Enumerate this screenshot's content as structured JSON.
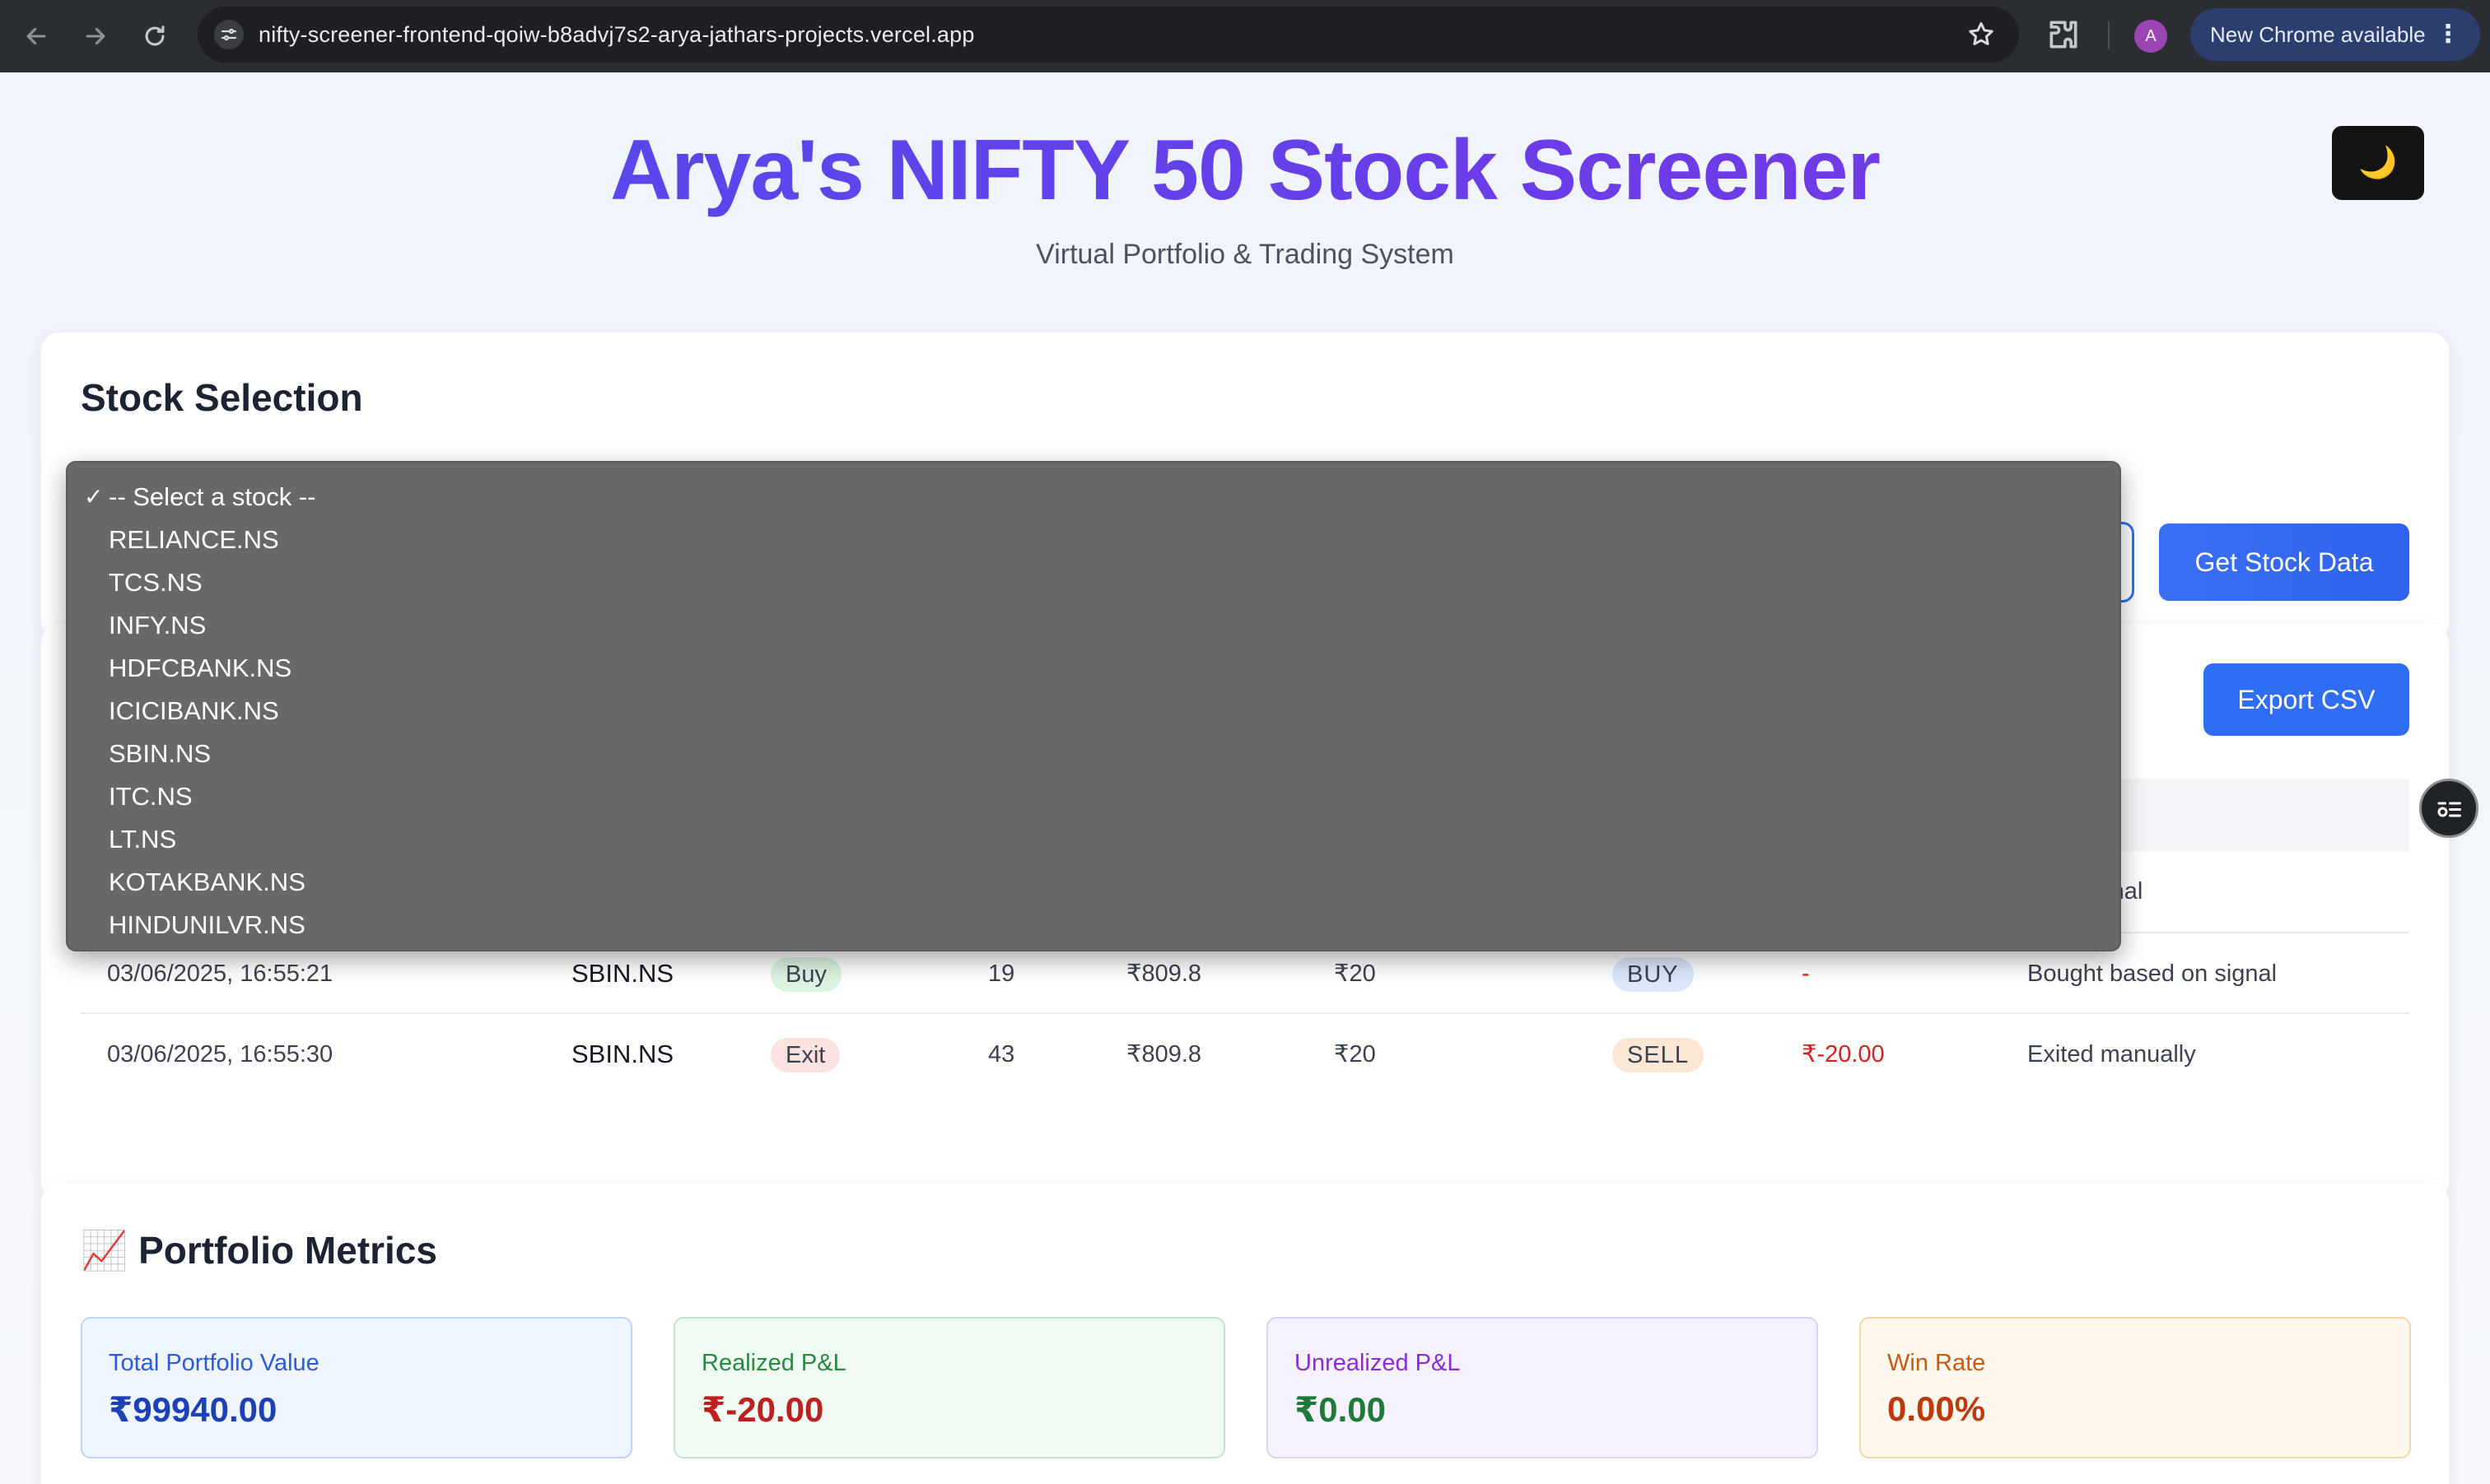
{
  "browser": {
    "url": "nifty-screener-frontend-qoiw-b8advj7s2-arya-jathars-projects.vercel.app",
    "profile_initial": "A",
    "update_label": "New Chrome available",
    "menu_glyph": "⋮"
  },
  "header": {
    "title": "Arya's NIFTY 50 Stock Screener",
    "subtitle": "Virtual Portfolio & Trading System",
    "theme_toggle_glyph": "🌙"
  },
  "stock_selection": {
    "heading": "Stock Selection",
    "selected": "-- Select a stock --",
    "get_data_label": "Get Stock Data",
    "options": [
      "-- Select a stock --",
      "RELIANCE.NS",
      "TCS.NS",
      "INFY.NS",
      "HDFCBANK.NS",
      "ICICIBANK.NS",
      "SBIN.NS",
      "ITC.NS",
      "LT.NS",
      "KOTAKBANK.NS",
      "HINDUNILVR.NS"
    ],
    "check_glyph": "✓"
  },
  "trades": {
    "export_label": "Export CSV",
    "partial_note": "d on signal",
    "rows": [
      {
        "time": "03/06/2025, 16:55:21",
        "symbol": "SBIN.NS",
        "type": "Buy",
        "qty": "19",
        "price": "₹809.8",
        "fee": "₹20",
        "action": "BUY",
        "pnl": "-",
        "note": "Bought based on signal"
      },
      {
        "time": "03/06/2025, 16:55:30",
        "symbol": "SBIN.NS",
        "type": "Exit",
        "qty": "43",
        "price": "₹809.8",
        "fee": "₹20",
        "action": "SELL",
        "pnl": "₹-20.00",
        "note": "Exited manually"
      }
    ]
  },
  "metrics": {
    "heading_icon": "📈",
    "heading": "Portfolio Metrics",
    "cards": [
      {
        "label": "Total Portfolio Value",
        "value": "₹99940.00"
      },
      {
        "label": "Realized P&L",
        "value": "₹-20.00"
      },
      {
        "label": "Unrealized P&L",
        "value": "₹0.00"
      },
      {
        "label": "Win Rate",
        "value": "0.00%"
      }
    ]
  }
}
